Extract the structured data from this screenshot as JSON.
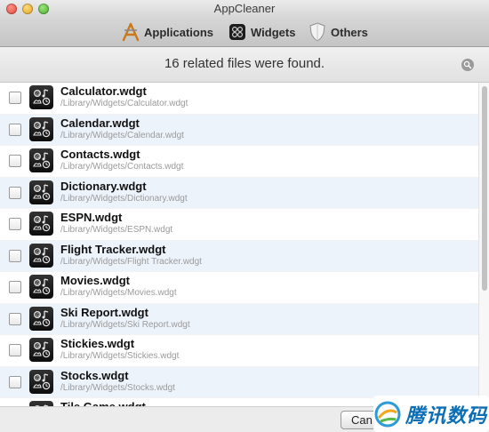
{
  "window": {
    "title": "AppCleaner"
  },
  "toolbar": {
    "tabs": [
      {
        "label": "Applications",
        "icon": "applications-icon"
      },
      {
        "label": "Widgets",
        "icon": "widgets-icon",
        "selected": true
      },
      {
        "label": "Others",
        "icon": "others-icon"
      }
    ]
  },
  "header": {
    "message": "16 related files were found."
  },
  "files": [
    {
      "name": "Calculator.wdgt",
      "path": "/Library/Widgets/Calculator.wdgt",
      "checked": false
    },
    {
      "name": "Calendar.wdgt",
      "path": "/Library/Widgets/Calendar.wdgt",
      "checked": false
    },
    {
      "name": "Contacts.wdgt",
      "path": "/Library/Widgets/Contacts.wdgt",
      "checked": false
    },
    {
      "name": "Dictionary.wdgt",
      "path": "/Library/Widgets/Dictionary.wdgt",
      "checked": false
    },
    {
      "name": "ESPN.wdgt",
      "path": "/Library/Widgets/ESPN.wdgt",
      "checked": false
    },
    {
      "name": "Flight Tracker.wdgt",
      "path": "/Library/Widgets/Flight Tracker.wdgt",
      "checked": false
    },
    {
      "name": "Movies.wdgt",
      "path": "/Library/Widgets/Movies.wdgt",
      "checked": false
    },
    {
      "name": "Ski Report.wdgt",
      "path": "/Library/Widgets/Ski Report.wdgt",
      "checked": false
    },
    {
      "name": "Stickies.wdgt",
      "path": "/Library/Widgets/Stickies.wdgt",
      "checked": false
    },
    {
      "name": "Stocks.wdgt",
      "path": "/Library/Widgets/Stocks.wdgt",
      "checked": false
    },
    {
      "name": "Tile Game.wdgt",
      "path": "",
      "checked": false
    }
  ],
  "footer": {
    "cancel_label": "Can"
  },
  "watermark": {
    "text": "腾讯数码"
  },
  "colors": {
    "row_alt": "#edf3fb",
    "brand_watermark": "#0b6fb6"
  }
}
